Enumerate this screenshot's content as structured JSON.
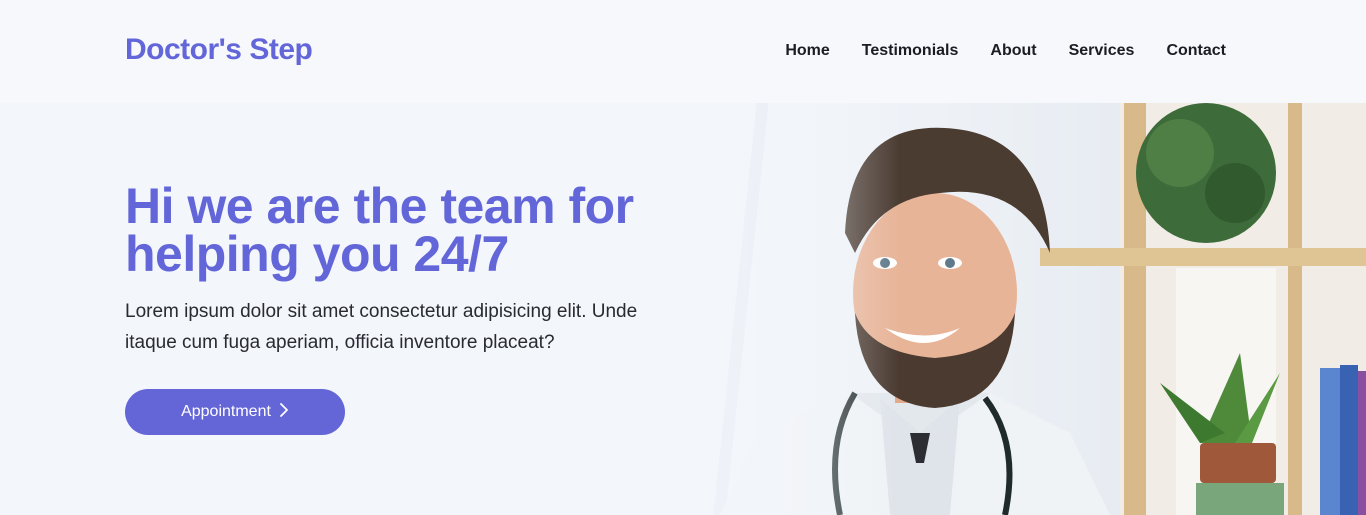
{
  "header": {
    "logo": "Doctor's Step",
    "nav": [
      {
        "label": "Home"
      },
      {
        "label": "Testimonials"
      },
      {
        "label": "About"
      },
      {
        "label": "Services"
      },
      {
        "label": "Contact"
      }
    ]
  },
  "hero": {
    "title_line1": "Hi we are the team for",
    "title_line2": "helping you 24/7",
    "description": "Lorem ipsum dolor sit amet consectetur adipisicing elit. Unde itaque cum fuga aperiam, officia inventore placeat?",
    "cta_label": "Appointment",
    "cta_icon": "chevron-right-icon"
  },
  "colors": {
    "accent": "#6366d8",
    "text_dark": "#1c1c24",
    "background": "#f7f8fc"
  }
}
